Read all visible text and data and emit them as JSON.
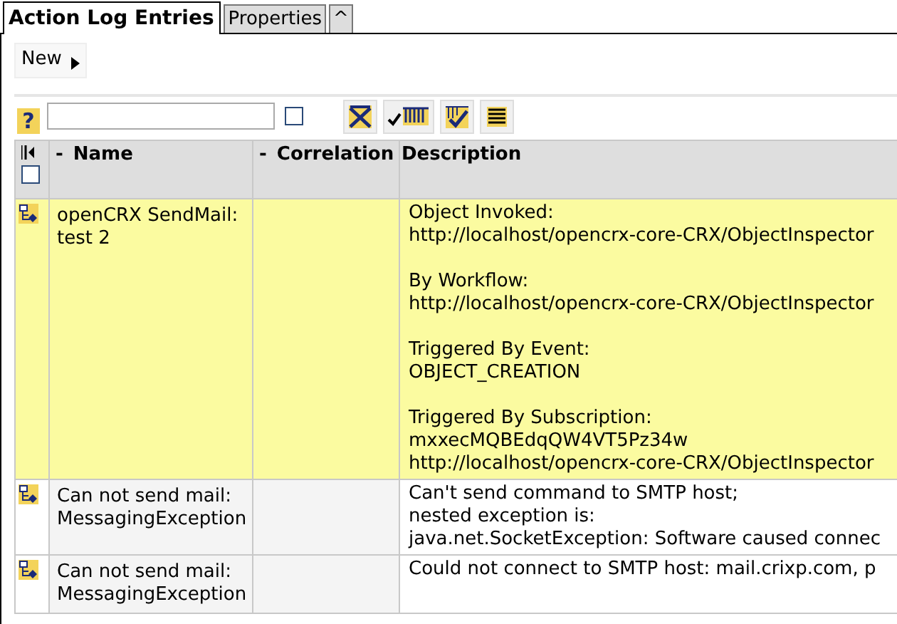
{
  "tabs": [
    {
      "label": "Action Log Entries",
      "selected": true
    },
    {
      "label": "Properties",
      "selected": false
    },
    {
      "label": "^",
      "selected": false
    }
  ],
  "toolbar": {
    "new_menu": "New"
  },
  "filter": {
    "help": "?",
    "checked": false
  },
  "table": {
    "columns": [
      {
        "label": "Name",
        "sort_marker": "-"
      },
      {
        "label": "Correlation",
        "sort_marker": "-"
      },
      {
        "label": "Description"
      }
    ],
    "select_all_checked": false,
    "rows": [
      {
        "selected": true,
        "name": "openCRX SendMail: test 2",
        "correlation": "",
        "description": [
          [
            "Object Invoked:",
            "http://localhost/opencrx-core-CRX/ObjectInspector"
          ],
          [
            "By Workflow:",
            "http://localhost/opencrx-core-CRX/ObjectInspector"
          ],
          [
            "Triggered By Event:",
            "OBJECT_CREATION"
          ],
          [
            "Triggered By Subscription:",
            "mxxecMQBEdqQW4VT5Pz34w",
            "http://localhost/opencrx-core-CRX/ObjectInspector"
          ]
        ]
      },
      {
        "selected": false,
        "name": "Can not send mail: MessagingException",
        "correlation": "",
        "description": [
          [
            "Can't send command to SMTP host;",
            "nested exception is:",
            "java.net.SocketException: Software caused connec"
          ]
        ]
      },
      {
        "selected": false,
        "name": "Can not send mail: MessagingException",
        "correlation": "",
        "description": [
          [
            "Could not connect to SMTP host: mail.crixp.com, p"
          ]
        ]
      }
    ]
  }
}
